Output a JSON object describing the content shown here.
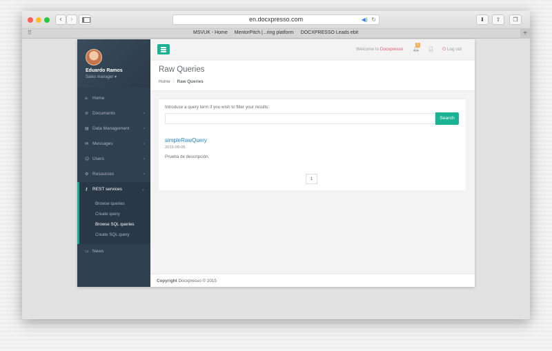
{
  "browser": {
    "url": "en.docxpresso.com",
    "bookmarks": [
      "MSVUK - Home",
      "MentorPitch |...ring platform",
      "DOCXPRESSO Leads ebit"
    ]
  },
  "sidebar": {
    "profile_name": "Eduardo Ramos",
    "profile_role": "Sales manager",
    "items": [
      {
        "label": "Home",
        "icon": "home-icon"
      },
      {
        "label": "Documents",
        "icon": "documents-icon"
      },
      {
        "label": "Data Management",
        "icon": "data-icon"
      },
      {
        "label": "Messages",
        "icon": "envelope-icon"
      },
      {
        "label": "Users",
        "icon": "users-icon"
      },
      {
        "label": "Resources",
        "icon": "cogs-icon"
      },
      {
        "label": "REST services",
        "icon": "key-icon"
      },
      {
        "label": "News",
        "icon": "newspaper-icon"
      }
    ],
    "rest_sub": [
      "Browse queries",
      "Create query",
      "Browse SQL queries",
      "Create SQL query"
    ]
  },
  "topbar": {
    "welcome_prefix": "Welcome to",
    "welcome_brand": "Docxpresso",
    "notification_count": "1",
    "logout_label": "Log out"
  },
  "heading": {
    "title": "Raw Queries",
    "crumb_home": "Home",
    "crumb_current": "Raw Queries"
  },
  "content": {
    "filter_label": "Introduce a query term if you wish to filter your results:",
    "search_value": "",
    "search_button": "Search",
    "result_title": "simpleRawQuery",
    "result_date": "2015-09-05",
    "result_desc": "Prueba de descripción.",
    "page_number": "1"
  },
  "footer": {
    "copyright_bold": "Copyright",
    "copyright_rest": "Docxpresso © 2015"
  },
  "colors": {
    "accent": "#1ab394",
    "sidebar_bg": "#2f4050",
    "link": "#1c84c6",
    "brand_red": "#ed5565"
  }
}
